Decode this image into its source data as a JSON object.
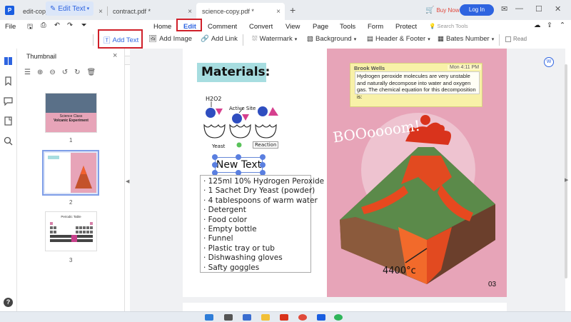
{
  "tabs": [
    {
      "label": "edit-copy.pdf",
      "active": false
    },
    {
      "label": "contract.pdf *",
      "active": false
    },
    {
      "label": "science-copy.pdf *",
      "active": true
    }
  ],
  "header": {
    "buy_now": "Buy Now",
    "login": "Log In"
  },
  "menu": {
    "file": "File",
    "items": [
      "Home",
      "Edit",
      "Comment",
      "Convert",
      "View",
      "Page",
      "Tools",
      "Form",
      "Protect"
    ],
    "search_placeholder": "Search Tools"
  },
  "toolbar": {
    "edit_text": "Edit Text",
    "add_text": "Add Text",
    "add_image": "Add Image",
    "add_link": "Add Link",
    "watermark": "Watermark",
    "background": "Background",
    "header_footer": "Header & Footer",
    "bates_number": "Bates Number",
    "read": "Read"
  },
  "thumbnail_panel": {
    "title": "Thumbnail",
    "pages": [
      {
        "number": "1",
        "title": "Science Class",
        "subtitle": "Volcanic Experiment"
      },
      {
        "number": "2"
      },
      {
        "number": "3",
        "title": "Periodic Table"
      }
    ]
  },
  "document": {
    "heading": "Materials:",
    "diagram_labels": {
      "h2o2": "H2O2",
      "active_site": "Active Site",
      "yeast": "Yeast",
      "reaction": "Reaction"
    },
    "new_text": "New Text",
    "materials": [
      "· 125ml 10% Hydrogen Peroxide",
      "· 1 Sachet Dry Yeast (powder)",
      "· 4 tablespoons of warm water",
      "· Detergent",
      "· Food color",
      "· Empty bottle",
      "· Funnel",
      "· Plastic tray or tub",
      "· Dishwashing gloves",
      "· Safty goggles"
    ],
    "note": {
      "author": "Brook Wells",
      "time": "Mon 4:11 PM",
      "body": "Hydrogen peroxide molecules are very unstable and naturally decompose into water and oxygen gas. The chemical equation for this decomposition is:"
    },
    "boom_text": "BOOoooom!",
    "temperature": "4400°c",
    "page_number": "03"
  },
  "colors": {
    "accent": "#2e64e0",
    "highlight_border": "#d0202a",
    "pink_panel": "#e7a4b8",
    "materials_bg": "#a7dde0",
    "note_bg": "#f8f1a8"
  }
}
